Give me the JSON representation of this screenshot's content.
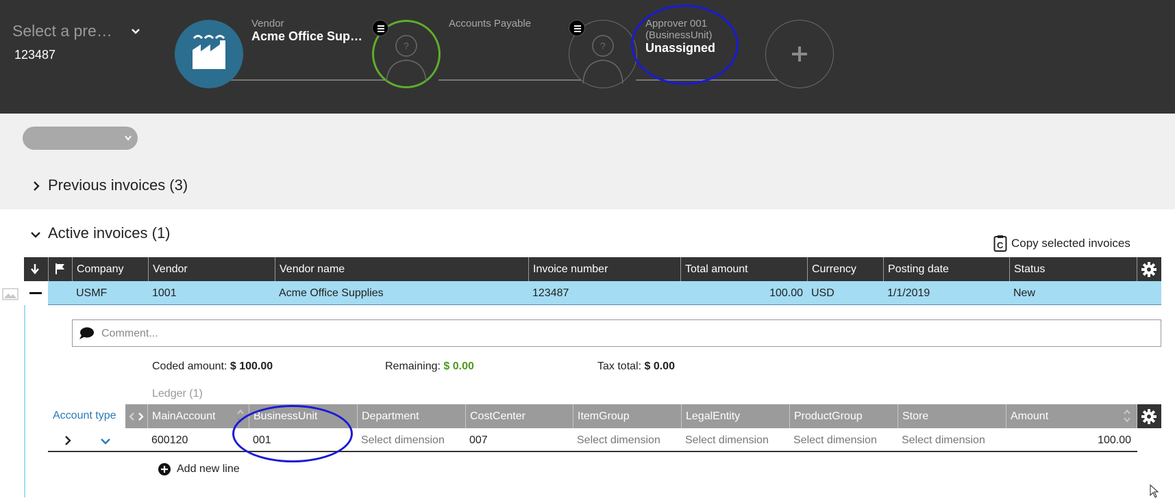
{
  "topbar": {
    "preset_placeholder": "Select a pre…",
    "document_number": "123487",
    "vendor_caption": "Vendor",
    "vendor_name": "Acme Office Sup…",
    "ap_caption": "Accounts Payable",
    "approver_caption_1": "Approver 001",
    "approver_caption_2": "(BusinessUnit)",
    "approver_status": "Unassigned",
    "add_symbol": "+"
  },
  "sections": {
    "previous": "Previous invoices (3)",
    "active": "Active invoices (1)"
  },
  "toolbar": {
    "copy_label": "Copy selected invoices"
  },
  "invoice_grid": {
    "headers": [
      "Company",
      "Vendor",
      "Vendor name",
      "Invoice number",
      "Total amount",
      "Currency",
      "Posting date",
      "Status"
    ],
    "row": {
      "company": "USMF",
      "vendor": "1001",
      "vendor_name": "Acme Office Supplies",
      "invoice_number": "123487",
      "total_amount": "100.00",
      "currency": "USD",
      "posting_date": "1/1/2019",
      "status": "New"
    }
  },
  "detail": {
    "comment_placeholder": "Comment...",
    "coded_label": "Coded amount:",
    "coded_value": "$ 100.00",
    "remaining_label": "Remaining:",
    "remaining_value": "$ 0.00",
    "tax_label": "Tax total:",
    "tax_value": "$ 0.00",
    "ledger_label": "Ledger (1)",
    "account_type_label": "Account type",
    "add_new_line": "Add new line"
  },
  "ledger_grid": {
    "headers": [
      "MainAccount",
      "BusinessUnit",
      "Department",
      "CostCenter",
      "ItemGroup",
      "LegalEntity",
      "ProductGroup",
      "Store",
      "Amount"
    ],
    "row": {
      "main_account": "600120",
      "business_unit": "001",
      "department": "Select dimension",
      "cost_center": "007",
      "item_group": "Select dimension",
      "legal_entity": "Select dimension",
      "product_group": "Select dimension",
      "store": "Select dimension",
      "amount": "100.00"
    }
  },
  "colors": {
    "topbar": "#333333",
    "vendor_node": "#2c6e8f",
    "ap_ring": "#5fae2a",
    "selected_row": "#a4dcf3",
    "annotation_oval": "#1a1ad6",
    "remaining_green": "#4e9a1c"
  }
}
